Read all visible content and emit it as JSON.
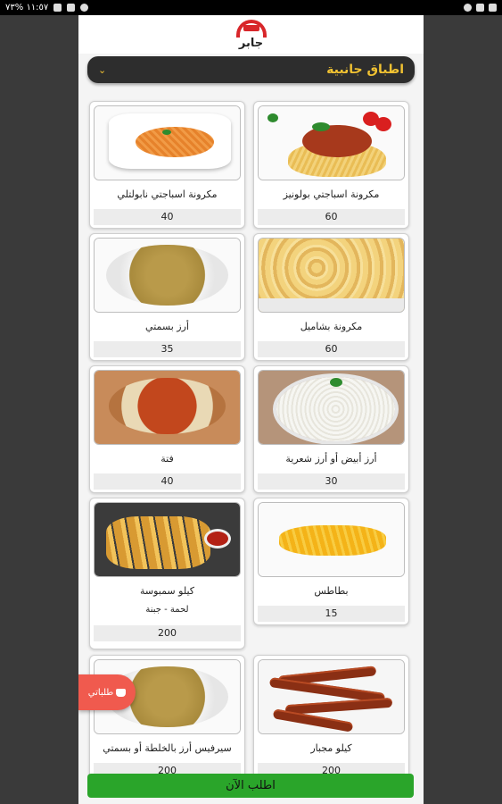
{
  "status_bar": {
    "time_text": "١١:٥٧ %٧٣"
  },
  "brand": {
    "logo_text": "جابر"
  },
  "category": {
    "label": "اطباق جانبية"
  },
  "items": [
    {
      "name": "مكرونة اسباجتي بولونيز",
      "price": "60"
    },
    {
      "name": "مكرونة اسباجتي نابولتلي",
      "price": "40"
    },
    {
      "name": "مكرونة بشاميل",
      "price": "60"
    },
    {
      "name": "أرز بسمتي",
      "price": "35"
    },
    {
      "name": "أرز أبيض أو أرز شعرية",
      "price": "30"
    },
    {
      "name": "فتة",
      "price": "40"
    },
    {
      "name": "بطاطس",
      "price": "15"
    },
    {
      "name": "كيلو سمبوسة",
      "subtitle": "لحمة - جبنة",
      "price": "200"
    },
    {
      "name": "كيلو مجبار",
      "price": "200"
    },
    {
      "name": "سيرفيس أرز بالخلطة أو بسمتي",
      "price": "200"
    }
  ],
  "cart_fab": {
    "label": "طلباتي"
  },
  "order_button": {
    "label": "اطلب الآن"
  },
  "colors": {
    "category_bg": "#2d2d2d",
    "category_text": "#f1c232",
    "order_btn": "#2aa52a",
    "fab": "#f05a4e",
    "brand_red": "#d8262a"
  }
}
